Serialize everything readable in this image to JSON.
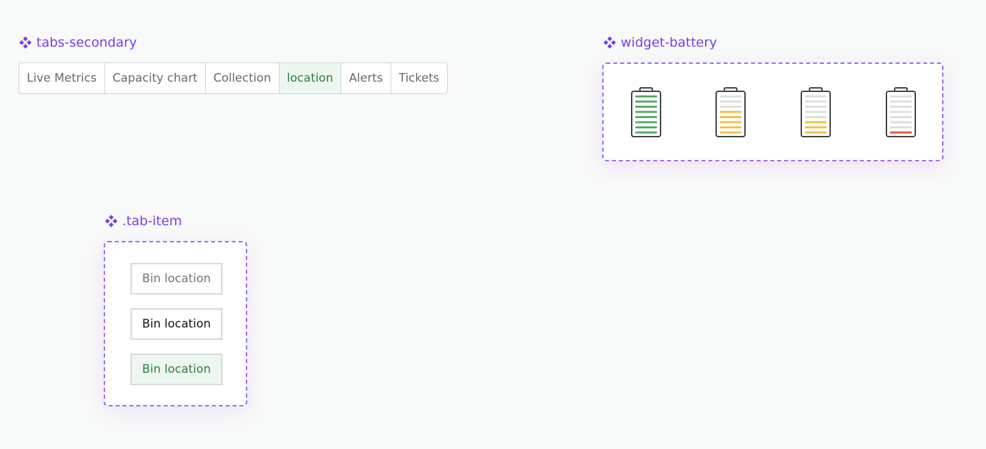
{
  "components": {
    "tabs": {
      "label": "tabs-secondary",
      "items": [
        {
          "label": "Live Metrics",
          "active": false
        },
        {
          "label": "Capacity chart",
          "active": false
        },
        {
          "label": "Collection",
          "active": false
        },
        {
          "label": "location",
          "active": true
        },
        {
          "label": "Alerts",
          "active": false
        },
        {
          "label": "Tickets",
          "active": false
        }
      ]
    },
    "battery": {
      "label": "widget-battery",
      "levels": [
        {
          "state": "full",
          "filled": 8,
          "color": "#5aa86a"
        },
        {
          "state": "medium",
          "filled": 5,
          "color": "#f0c14b"
        },
        {
          "state": "low",
          "filled": 3,
          "color": "#f0c14b"
        },
        {
          "state": "critical",
          "filled": 1,
          "color": "#e0573a"
        }
      ],
      "empty_color": "#dcdfe0"
    },
    "tab_item": {
      "label": ".tab-item",
      "states": [
        {
          "label": "Bin location",
          "state": "default"
        },
        {
          "label": "Bin location",
          "state": "hover"
        },
        {
          "label": "Bin location",
          "state": "selected"
        }
      ]
    }
  },
  "colors": {
    "accent": "#7b3fe4",
    "active_bg": "#edf7ef",
    "active_text": "#2f7d45"
  },
  "icons": {
    "component": "component-diamond-icon",
    "battery": "battery-icon"
  }
}
